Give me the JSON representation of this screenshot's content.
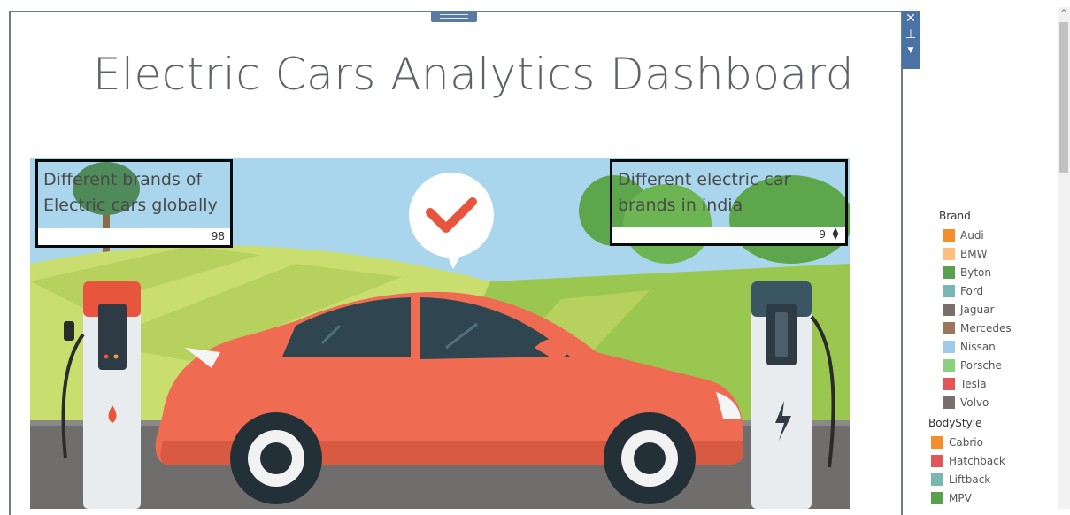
{
  "dashboard": {
    "title": "Electric Cars Analytics Dashboard"
  },
  "kpis": [
    {
      "label": "Different brands of Electric cars globally",
      "value": "98"
    },
    {
      "label": "Different electric car brands in india",
      "value": "9"
    }
  ],
  "toolbar": {
    "close_icon": "close-icon",
    "pin_icon": "pin-icon",
    "menu_icon": "caret-down-icon"
  },
  "legend": {
    "brand_title": "Brand",
    "brand_items": [
      {
        "label": "Audi",
        "color": "#f28e2b"
      },
      {
        "label": "BMW",
        "color": "#ffbe7d"
      },
      {
        "label": "Byton",
        "color": "#59a14f"
      },
      {
        "label": "Ford",
        "color": "#76b7b2"
      },
      {
        "label": "Jaguar",
        "color": "#79706e"
      },
      {
        "label": "Mercedes",
        "color": "#9c755f"
      },
      {
        "label": "Nissan",
        "color": "#a0cbe8"
      },
      {
        "label": "Porsche",
        "color": "#8cd17d"
      },
      {
        "label": "Tesla",
        "color": "#e15759"
      },
      {
        "label": "Volvo",
        "color": "#79706e"
      }
    ],
    "bodystyle_title": "BodyStyle",
    "bodystyle_items": [
      {
        "label": "Cabrio",
        "color": "#f28e2b"
      },
      {
        "label": "Hatchback",
        "color": "#e15759"
      },
      {
        "label": "Liftback",
        "color": "#76b7b2"
      },
      {
        "label": "MPV",
        "color": "#59a14f"
      }
    ]
  }
}
